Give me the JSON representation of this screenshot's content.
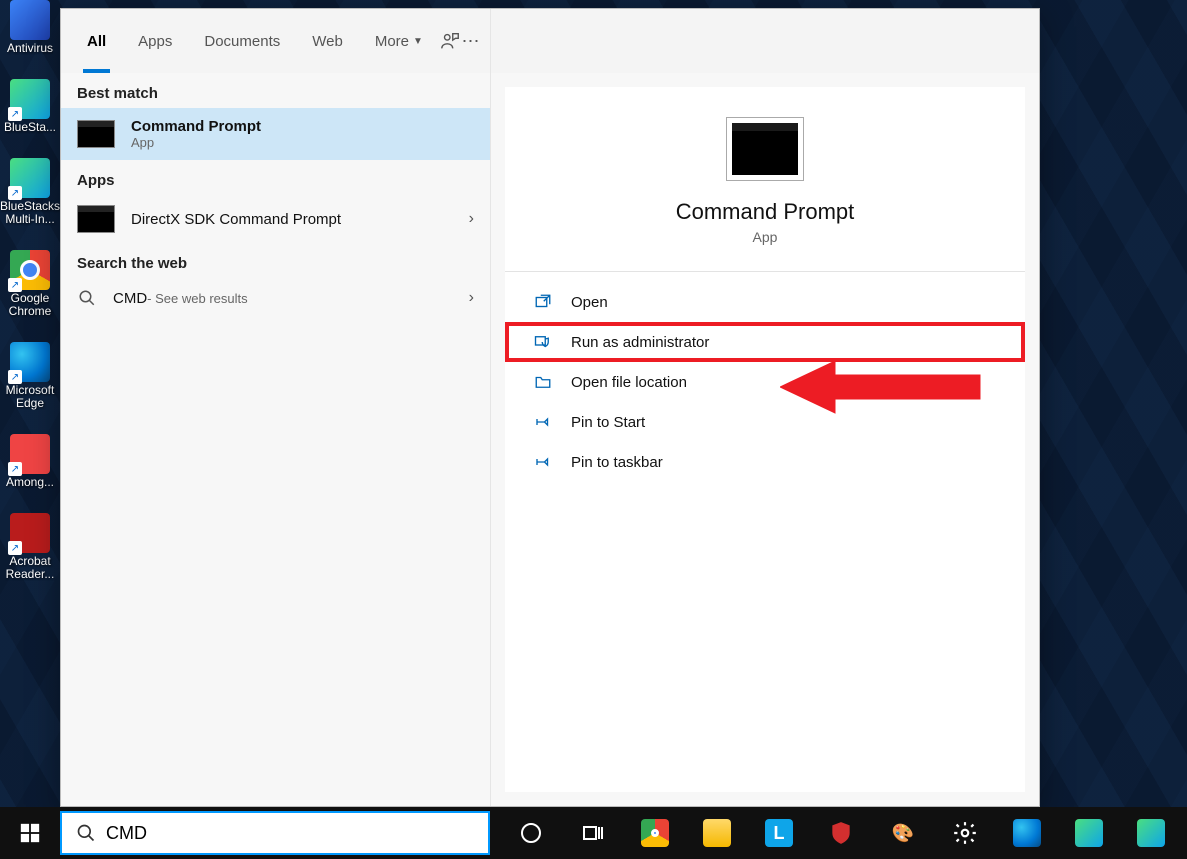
{
  "desktop": {
    "icons": [
      {
        "label": "Antivirus"
      },
      {
        "label": "BlueSta..."
      },
      {
        "label": "BlueStacks Multi-In..."
      },
      {
        "label": "Google Chrome"
      },
      {
        "label": "Microsoft Edge"
      },
      {
        "label": "Among..."
      },
      {
        "label": "Acrobat Reader..."
      }
    ]
  },
  "tabs": {
    "all": "All",
    "apps": "Apps",
    "documents": "Documents",
    "web": "Web",
    "more": "More"
  },
  "sections": {
    "best_match": "Best match",
    "apps": "Apps",
    "search_web": "Search the web"
  },
  "results": {
    "cmd": {
      "title": "Command Prompt",
      "sub": "App"
    },
    "dx": {
      "title": "DirectX SDK Command Prompt"
    },
    "web": {
      "title": "CMD",
      "sub": " - See web results"
    }
  },
  "detail": {
    "title": "Command Prompt",
    "sub": "App",
    "actions": {
      "open": "Open",
      "admin": "Run as administrator",
      "location": "Open file location",
      "pin_start": "Pin to Start",
      "pin_taskbar": "Pin to taskbar"
    }
  },
  "searchbox": {
    "value": "CMD"
  },
  "colors": {
    "accent": "#0078d4",
    "highlight": "#ed1c24"
  }
}
